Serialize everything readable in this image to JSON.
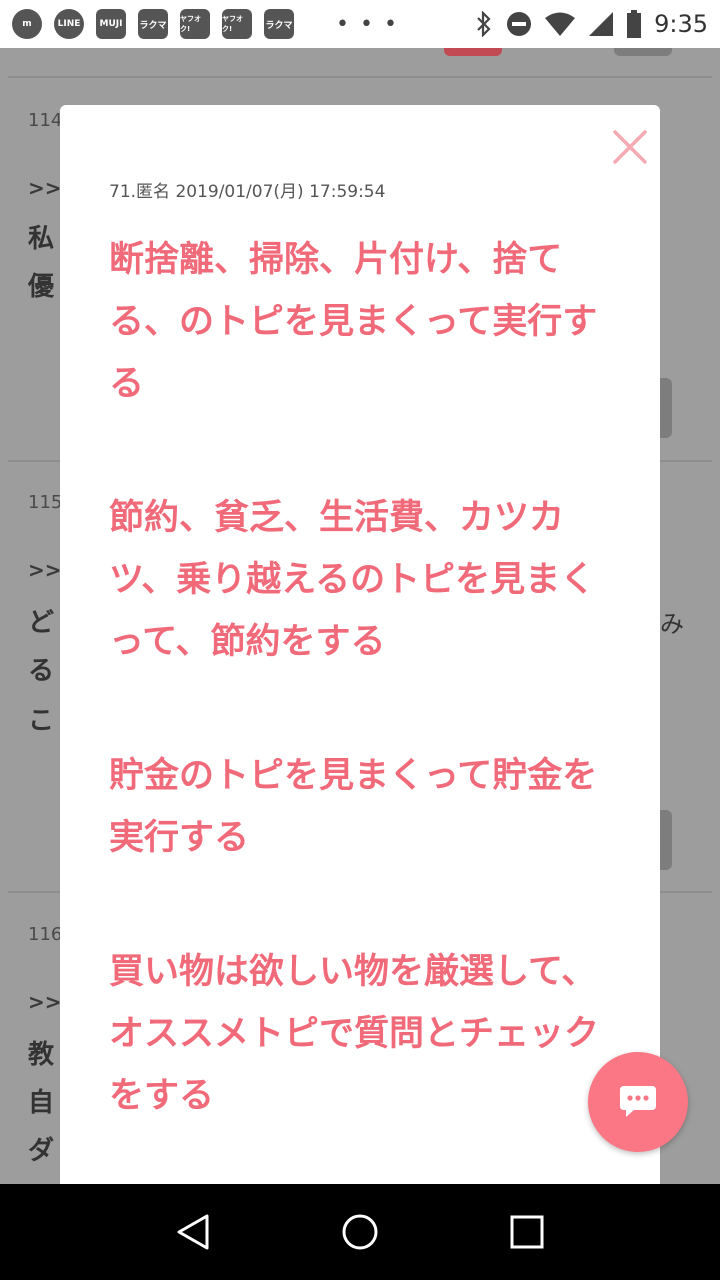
{
  "status_bar": {
    "apps": [
      {
        "icon": "mercari-icon",
        "label": "m"
      },
      {
        "icon": "line-icon",
        "label": "LINE"
      },
      {
        "icon": "muji-icon",
        "label": "MUJI"
      },
      {
        "icon": "rakuma-icon",
        "label": "ラクマ"
      },
      {
        "icon": "yahuoku-icon",
        "label": "ヤフオク!"
      },
      {
        "icon": "yahuoku-icon",
        "label": "ヤフオク!"
      },
      {
        "icon": "rakuma-icon",
        "label": "ラクマ"
      }
    ],
    "more": "• • •",
    "time": "9:35"
  },
  "background": {
    "numbers": [
      "114",
      "115",
      "116"
    ],
    "gt": ">>",
    "chars_114": [
      "私",
      "優"
    ],
    "chars_115": [
      "ど",
      "る",
      "こ"
    ],
    "chars_115_right": "み",
    "chars_116": [
      "教",
      "自",
      "ダ"
    ]
  },
  "modal": {
    "meta": "71.匿名 2019/01/07(月) 17:59:54",
    "paragraphs": [
      "断捨離、掃除、片付け、捨てる、のトピを見まくって実行する",
      "節約、貧乏、生活費、カツカツ、乗り越えるのトピを見まくって、節約をする",
      "貯金のトピを見まくって貯金を実行する",
      "買い物は欲しい物を厳選して、オススメトピで質問とチェックをする"
    ]
  },
  "colors": {
    "accent": "#f06a7a",
    "fab": "#fb7785",
    "close": "#f7a9b2"
  }
}
